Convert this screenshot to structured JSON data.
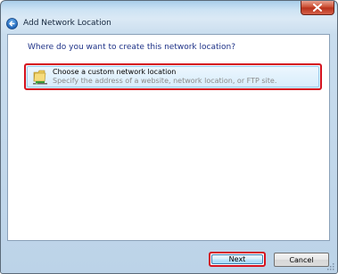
{
  "window": {
    "title": "Add Network Location"
  },
  "content": {
    "question": "Where do you want to create this network location?",
    "option": {
      "title": "Choose a custom network location",
      "description": "Specify the address of a website, network location, or FTP site."
    }
  },
  "footer": {
    "next_label": "Next",
    "cancel_label": "Cancel"
  },
  "colors": {
    "highlight": "#d5131f",
    "question_text": "#1e3287"
  }
}
